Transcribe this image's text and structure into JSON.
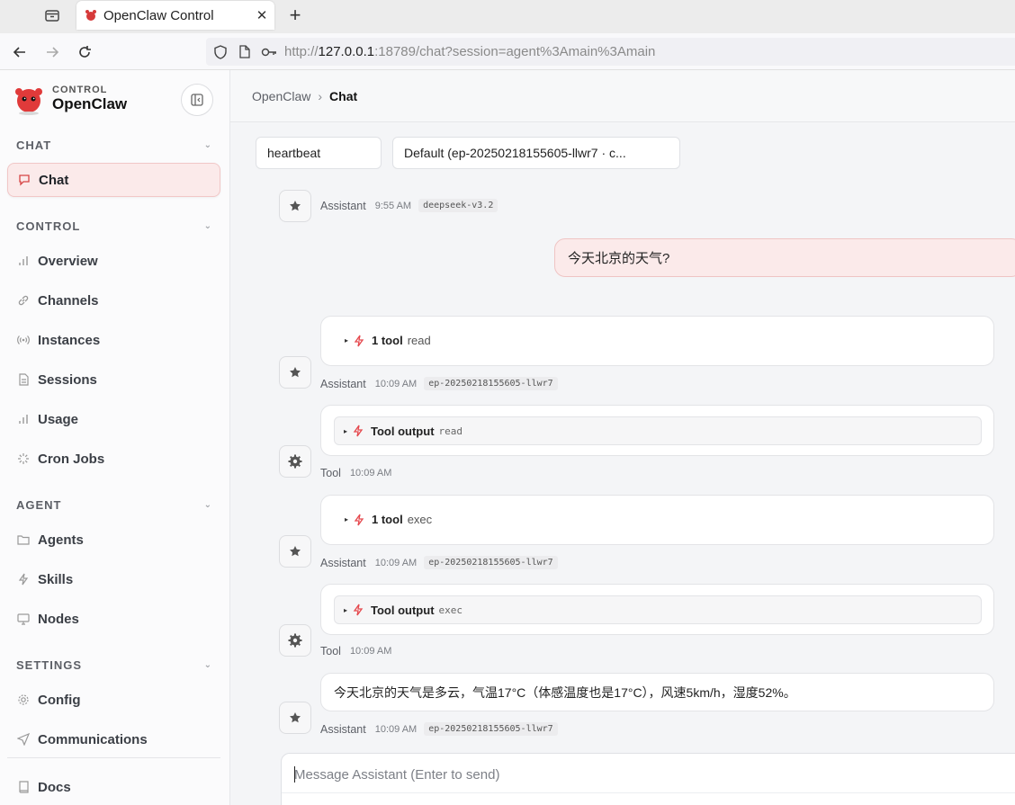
{
  "browser": {
    "tab_title": "OpenClaw Control",
    "url_prefix": "http://",
    "url_host": "127.0.0.1",
    "url_rest": ":18789/chat?session=agent%3Amain%3Amain"
  },
  "brand": {
    "sub": "CONTROL",
    "name": "OpenClaw"
  },
  "sidebar": {
    "sections": {
      "chat": "CHAT",
      "control": "CONTROL",
      "agent": "AGENT",
      "settings": "SETTINGS"
    },
    "items": {
      "chat": "Chat",
      "overview": "Overview",
      "channels": "Channels",
      "instances": "Instances",
      "sessions": "Sessions",
      "usage": "Usage",
      "cron": "Cron Jobs",
      "agents": "Agents",
      "skills": "Skills",
      "nodes": "Nodes",
      "config": "Config",
      "communications": "Communications",
      "docs": "Docs"
    }
  },
  "breadcrumb": {
    "root": "OpenClaw",
    "sep": "›",
    "current": "Chat"
  },
  "selectors": {
    "session": "heartbeat",
    "model": "Default (ep-20250218155605-llwr7 · c..."
  },
  "messages": {
    "m1": {
      "role": "Assistant",
      "time": "9:55 AM",
      "model": "deepseek-v3.2"
    },
    "user": "今天北京的天气?",
    "tool1": {
      "count": "1 tool",
      "name": "read",
      "role": "Assistant",
      "time": "10:09 AM",
      "model": "ep-20250218155605-llwr7"
    },
    "out1": {
      "label": "Tool output",
      "name": "read",
      "role": "Tool",
      "time": "10:09 AM"
    },
    "tool2": {
      "count": "1 tool",
      "name": "exec",
      "role": "Assistant",
      "time": "10:09 AM",
      "model": "ep-20250218155605-llwr7"
    },
    "out2": {
      "label": "Tool output",
      "name": "exec",
      "role": "Tool",
      "time": "10:09 AM"
    },
    "answer": {
      "text": "今天北京的天气是多云，气温17°C（体感温度也是17°C），风速5km/h，湿度52%。",
      "role": "Assistant",
      "time": "10:09 AM",
      "model": "ep-20250218155605-llwr7"
    }
  },
  "composer": {
    "placeholder": "Message Assistant (Enter to send)"
  },
  "colors": {
    "accent": "#e5484d",
    "active_bg": "#fbeaea"
  }
}
